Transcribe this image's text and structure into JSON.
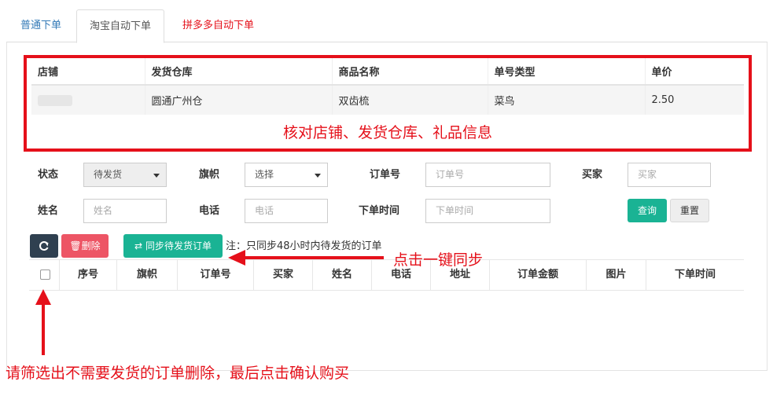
{
  "tabs": [
    {
      "label": "普通下单"
    },
    {
      "label": "淘宝自动下单"
    },
    {
      "label": "拼多多自动下单"
    }
  ],
  "shop_info": {
    "headers": [
      "店铺",
      "发货仓库",
      "商品名称",
      "单号类型",
      "单价"
    ],
    "row": {
      "warehouse": "圆通广州仓",
      "product": "双齿梳",
      "tracking_type": "菜鸟",
      "price": "2.50"
    }
  },
  "annotations": {
    "check_info": "核对店铺、发货仓库、礼品信息",
    "sync_hint": "点击一键同步",
    "delete_hint": "请筛选出不需要发货的订单删除，最后点击确认购买"
  },
  "filters": {
    "status_label": "状态",
    "status_value": "待发货",
    "flag_label": "旗帜",
    "flag_value": "选择",
    "order_no_label": "订单号",
    "order_no_placeholder": "订单号",
    "buyer_label": "买家",
    "buyer_placeholder": "买家",
    "name_label": "姓名",
    "name_placeholder": "姓名",
    "phone_label": "电话",
    "phone_placeholder": "电话",
    "order_time_label": "下单时间",
    "order_time_placeholder": "下单时间",
    "query_button": "查询",
    "reset_button": "重置"
  },
  "toolbar": {
    "refresh_icon": "refresh-icon",
    "delete_button": "删除",
    "sync_button": "同步待发货订单",
    "note": "注：只同步48小时内待发货的订单"
  },
  "order_table": {
    "headers": [
      "序号",
      "旗帜",
      "订单号",
      "买家",
      "姓名",
      "电话",
      "地址",
      "订单金额",
      "图片",
      "下单时间"
    ]
  },
  "colors": {
    "accent_red": "#e5101a",
    "teal": "#1ab394",
    "dark": "#2f4050",
    "danger": "#ed5565",
    "link_blue": "#337ab7"
  }
}
